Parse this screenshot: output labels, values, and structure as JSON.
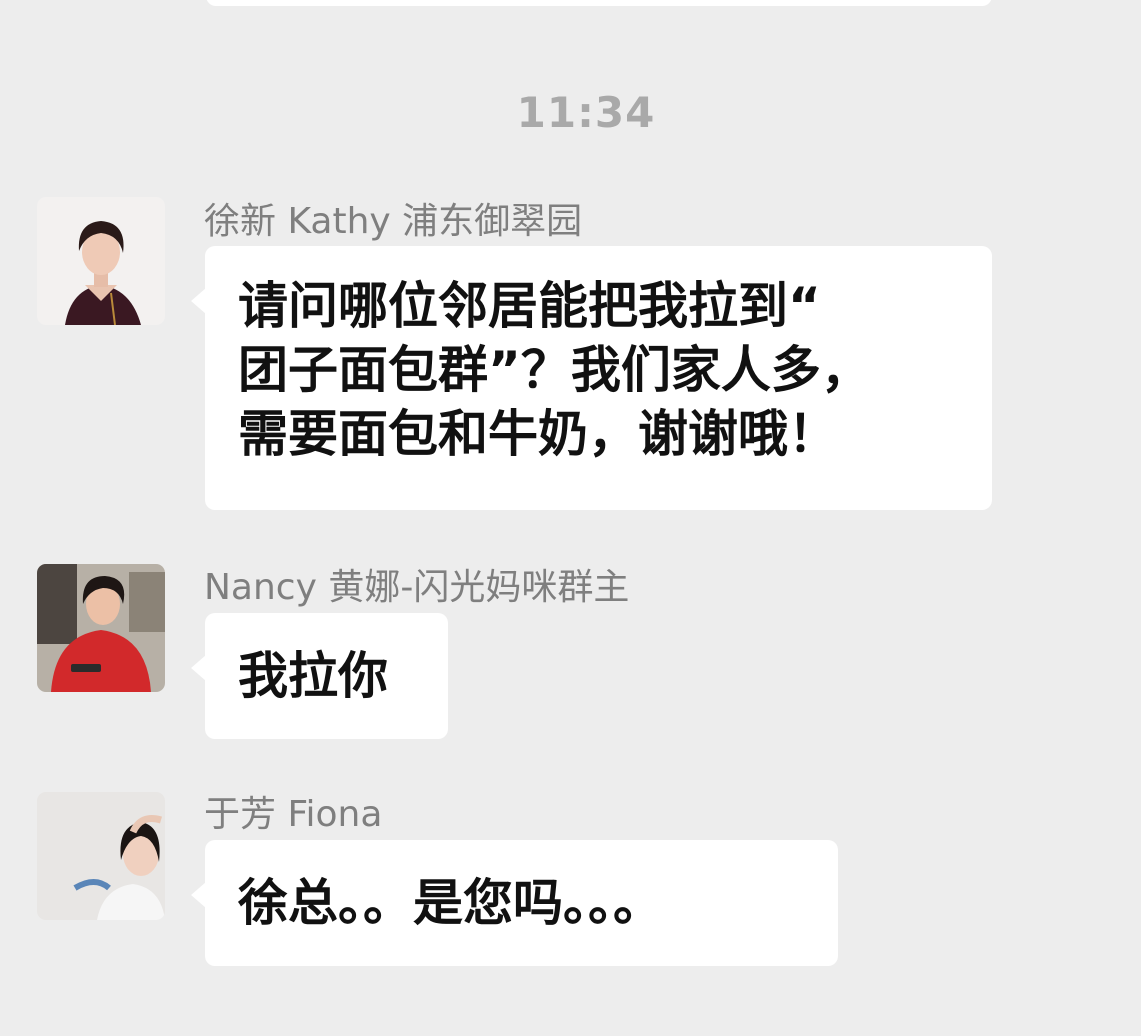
{
  "timestamp": "11:34",
  "messages": [
    {
      "sender": "徐新 Kathy 浦东御翠园",
      "avatar_icon": "woman-portrait-avatar-icon",
      "lines": [
        "请问哪位邻居能把我拉到“",
        "团子面包群”？我们家人多，",
        "需要面包和牛奶，谢谢哦！"
      ]
    },
    {
      "sender": "Nancy 黄娜-闪光妈咪群主",
      "avatar_icon": "woman-red-dress-avatar-icon",
      "lines": [
        "我拉你"
      ]
    },
    {
      "sender": "于芳 Fiona",
      "avatar_icon": "smiling-woman-avatar-icon",
      "lines": [
        "徐总。。是您吗。。。"
      ]
    }
  ],
  "colors": {
    "background": "#ededed",
    "bubble": "#ffffff",
    "sender_text": "#7f7f7f",
    "timestamp_text": "#a9a9a9",
    "message_text": "#111111"
  }
}
